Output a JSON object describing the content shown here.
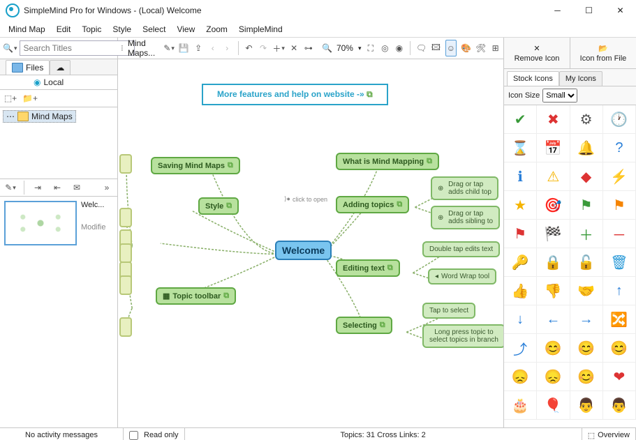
{
  "window": {
    "title": "SimpleMind Pro for Windows - (Local) Welcome"
  },
  "menu": [
    "Mind Map",
    "Edit",
    "Topic",
    "Style",
    "Select",
    "View",
    "Zoom",
    "SimpleMind"
  ],
  "search": {
    "placeholder": "Search Titles"
  },
  "filetabs": {
    "files": "Files"
  },
  "local": "Local",
  "tree": {
    "mindmaps": "Mind Maps"
  },
  "thumb": {
    "name": "Welc...",
    "mod": "Modifie"
  },
  "breadcrumb": "Mind Maps...",
  "zoom": "70%",
  "banner": "More features and help on website -»",
  "nodes": {
    "root": "Welcome",
    "saving": "Saving Mind Maps",
    "style": "Style",
    "toolbar": "Topic toolbar",
    "what": "What is Mind Mapping",
    "adding": "Adding topics",
    "editing": "Editing text",
    "selecting": "Selecting",
    "drag1": "Drag or tap\nadds child top",
    "drag2": "Drag or tap\nadds sibling to",
    "dtap": "Double tap edits text",
    "wrap": "Word Wrap tool",
    "tap": "Tap to select",
    "long": "Long press topic to\nselect topics in branch",
    "open": "click to open"
  },
  "right": {
    "remove": "Remove Icon",
    "fromfile": "Icon from File",
    "stock": "Stock Icons",
    "my": "My Icons",
    "sizelabel": "Icon Size",
    "size": "Small"
  },
  "icons": [
    "✔",
    "✖",
    "⚙",
    "🕐",
    "⌛",
    "📅",
    "🔔",
    "?",
    "ℹ",
    "⚠",
    "◆",
    "⚡",
    "★",
    "🎯",
    "⚑",
    "⚑",
    "⚑",
    "🏁",
    "＋",
    "－",
    "🔑",
    "🔒",
    "🔓",
    "🗑",
    "👍",
    "👎",
    "🤝",
    "↑",
    "↓",
    "←",
    "→",
    "🔀",
    "⤴",
    "😊",
    "😊",
    "😊",
    "😞",
    "😞",
    "😊",
    "❤",
    "🎂",
    "🎈",
    "👨",
    "👨"
  ],
  "status": {
    "noact": "No activity messages",
    "ro": "Read only",
    "topics": "Topics: 31  Cross Links: 2",
    "overview": "Overview"
  }
}
